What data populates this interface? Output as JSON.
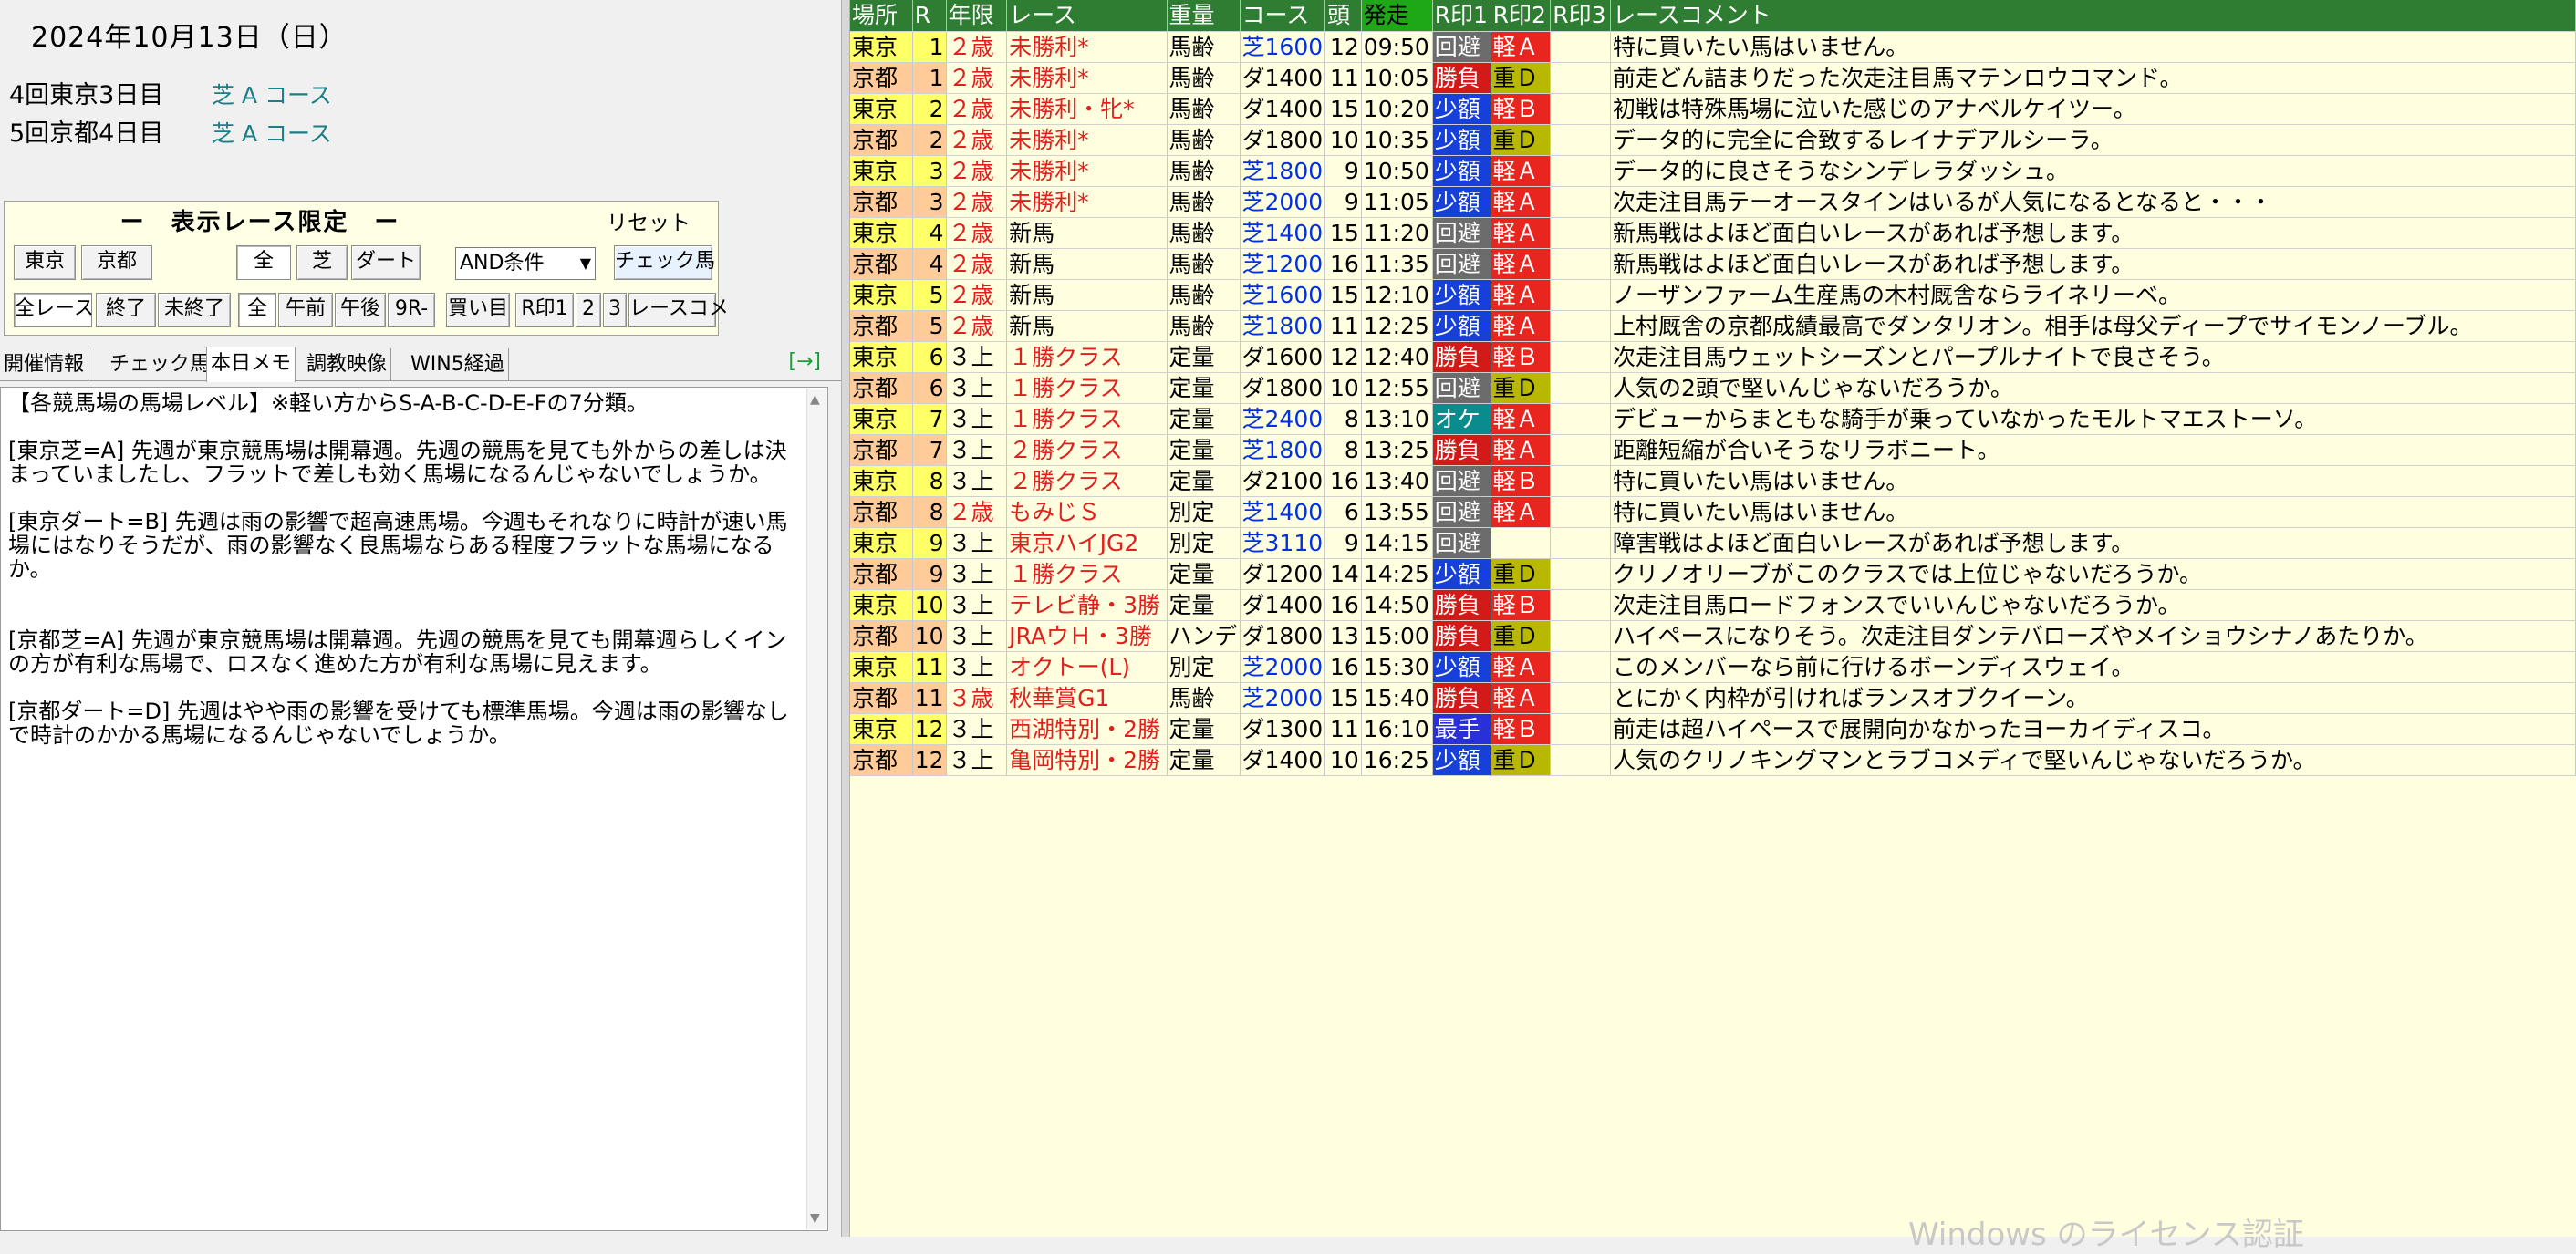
{
  "header": {
    "date": "2024年10月13日（日）",
    "meetings": [
      {
        "name": "4回東京3日目",
        "course": "芝 A コース"
      },
      {
        "name": "5回京都4日目",
        "course": "芝 A コース"
      }
    ]
  },
  "filter": {
    "title": "ー　表示レース限定　ー",
    "reset": "リセット",
    "row1": {
      "tokyo": "東京",
      "kyoto": "京都",
      "all": "全",
      "turf": "芝",
      "dirt": "ダート",
      "condition": "AND条件",
      "check_horse": "チェック馬"
    },
    "row2": {
      "all_races": "全レース",
      "finished": "終了",
      "unfinished": "未終了",
      "all": "全",
      "am": "午前",
      "pm": "午後",
      "r9": "9R-",
      "buy": "買い目",
      "rmark1": "R印1",
      "r2": "2",
      "r3": "3",
      "race_comment": "レースコメ"
    }
  },
  "tabs": {
    "items": [
      "開催情報",
      "チェック馬",
      "本日メモ",
      "調教映像",
      "WIN5経過"
    ],
    "active": "本日メモ",
    "arrow": "[→]"
  },
  "memo": {
    "text": "【各競馬場の馬場レベル】※軽い方からS-A-B-C-D-E-Fの7分類。\n\n[東京芝=A] 先週が東京競馬場は開幕週。先週の競馬を見ても外からの差しは決まっていましたし、フラットで差しも効く馬場になるんじゃないでしょうか。\n\n[東京ダート=B] 先週は雨の影響で超高速馬場。今週もそれなりに時計が速い馬場にはなりそうだが、雨の影響なく良馬場ならある程度フラットな馬場になるか。\n\n\n[京都芝=A] 先週が東京競馬場は開幕週。先週の競馬を見ても開幕週らしくインの方が有利な馬場で、ロスなく進めた方が有利な馬場に見えます。\n\n[京都ダート=D] 先週はやや雨の影響を受けても標準馬場。今週は雨の影響なしで時計のかかる馬場になるんじゃないでしょうか。"
  },
  "grid": {
    "headers": [
      "場所",
      "R",
      "年限",
      "レース",
      "重量",
      "コース",
      "頭",
      "発走",
      "R印1",
      "R印2",
      "R印3",
      "レースコメント"
    ],
    "rows": [
      {
        "venue": "東京",
        "r": "1",
        "age": "２歳",
        "race": "未勝利*",
        "weight": "馬齢",
        "course": "芝1600",
        "heads": "12",
        "start": "09:50",
        "r1": "回避",
        "r2": "軽Ａ",
        "r3": "",
        "comment": "特に買いたい馬はいません。"
      },
      {
        "venue": "京都",
        "r": "1",
        "age": "２歳",
        "race": "未勝利*",
        "weight": "馬齢",
        "course": "ダ1400",
        "heads": "11",
        "start": "10:05",
        "r1": "勝負",
        "r2": "重Ｄ",
        "r3": "",
        "comment": "前走どん詰まりだった次走注目馬マテンロウコマンド。"
      },
      {
        "venue": "東京",
        "r": "2",
        "age": "２歳",
        "race": "未勝利・牝*",
        "weight": "馬齢",
        "course": "ダ1400",
        "heads": "15",
        "start": "10:20",
        "r1": "少額",
        "r2": "軽Ｂ",
        "r3": "",
        "comment": "初戦は特殊馬場に泣いた感じのアナベルケイツー。"
      },
      {
        "venue": "京都",
        "r": "2",
        "age": "２歳",
        "race": "未勝利*",
        "weight": "馬齢",
        "course": "ダ1800",
        "heads": "10",
        "start": "10:35",
        "r1": "少額",
        "r2": "重Ｄ",
        "r3": "",
        "comment": "データ的に完全に合致するレイナデアルシーラ。"
      },
      {
        "venue": "東京",
        "r": "3",
        "age": "２歳",
        "race": "未勝利*",
        "weight": "馬齢",
        "course": "芝1800",
        "heads": "9",
        "start": "10:50",
        "r1": "少額",
        "r2": "軽Ａ",
        "r3": "",
        "comment": "データ的に良さそうなシンデレラダッシュ。"
      },
      {
        "venue": "京都",
        "r": "3",
        "age": "２歳",
        "race": "未勝利*",
        "weight": "馬齢",
        "course": "芝2000",
        "heads": "9",
        "start": "11:05",
        "r1": "少額",
        "r2": "軽Ａ",
        "r3": "",
        "comment": "次走注目馬テーオースタインはいるが人気になるとなると・・・"
      },
      {
        "venue": "東京",
        "r": "4",
        "age": "２歳",
        "race": "新馬",
        "weight": "馬齢",
        "course": "芝1400",
        "heads": "15",
        "start": "11:20",
        "r1": "回避",
        "r2": "軽Ａ",
        "r3": "",
        "comment": "新馬戦はよほど面白いレースがあれば予想します。"
      },
      {
        "venue": "京都",
        "r": "4",
        "age": "２歳",
        "race": "新馬",
        "weight": "馬齢",
        "course": "芝1200",
        "heads": "16",
        "start": "11:35",
        "r1": "回避",
        "r2": "軽Ａ",
        "r3": "",
        "comment": "新馬戦はよほど面白いレースがあれば予想します。"
      },
      {
        "venue": "東京",
        "r": "5",
        "age": "２歳",
        "race": "新馬",
        "weight": "馬齢",
        "course": "芝1600",
        "heads": "15",
        "start": "12:10",
        "r1": "少額",
        "r2": "軽Ａ",
        "r3": "",
        "comment": "ノーザンファーム生産馬の木村厩舎ならライネリーベ。"
      },
      {
        "venue": "京都",
        "r": "5",
        "age": "２歳",
        "race": "新馬",
        "weight": "馬齢",
        "course": "芝1800",
        "heads": "11",
        "start": "12:25",
        "r1": "少額",
        "r2": "軽Ａ",
        "r3": "",
        "comment": "上村厩舎の京都成績最高でダンタリオン。相手は母父ディープでサイモンノーブル。"
      },
      {
        "venue": "東京",
        "r": "6",
        "age": "３上",
        "race": "１勝クラス",
        "weight": "定量",
        "course": "ダ1600",
        "heads": "12",
        "start": "12:40",
        "r1": "勝負",
        "r2": "軽Ｂ",
        "r3": "",
        "comment": "次走注目馬ウェットシーズンとパープルナイトで良さそう。"
      },
      {
        "venue": "京都",
        "r": "6",
        "age": "３上",
        "race": "１勝クラス",
        "weight": "定量",
        "course": "ダ1800",
        "heads": "10",
        "start": "12:55",
        "r1": "回避",
        "r2": "重Ｄ",
        "r3": "",
        "comment": "人気の2頭で堅いんじゃないだろうか。"
      },
      {
        "venue": "東京",
        "r": "7",
        "age": "３上",
        "race": "１勝クラス",
        "weight": "定量",
        "course": "芝2400",
        "heads": "8",
        "start": "13:10",
        "r1": "オケ",
        "r2": "軽Ａ",
        "r3": "",
        "comment": "デビューからまともな騎手が乗っていなかったモルトマエストーソ。"
      },
      {
        "venue": "京都",
        "r": "7",
        "age": "３上",
        "race": "２勝クラス",
        "weight": "定量",
        "course": "芝1800",
        "heads": "8",
        "start": "13:25",
        "r1": "勝負",
        "r2": "軽Ａ",
        "r3": "",
        "comment": "距離短縮が合いそうなリラボニート。"
      },
      {
        "venue": "東京",
        "r": "8",
        "age": "３上",
        "race": "２勝クラス",
        "weight": "定量",
        "course": "ダ2100",
        "heads": "16",
        "start": "13:40",
        "r1": "回避",
        "r2": "軽Ｂ",
        "r3": "",
        "comment": "特に買いたい馬はいません。"
      },
      {
        "venue": "京都",
        "r": "8",
        "age": "２歳",
        "race": "もみじＳ",
        "weight": "別定",
        "course": "芝1400",
        "heads": "6",
        "start": "13:55",
        "r1": "回避",
        "r2": "軽Ａ",
        "r3": "",
        "comment": "特に買いたい馬はいません。"
      },
      {
        "venue": "東京",
        "r": "9",
        "age": "３上",
        "race": "東京ハイJG2",
        "weight": "別定",
        "course": "芝3110",
        "heads": "9",
        "start": "14:15",
        "r1": "回避",
        "r2": "",
        "r3": "",
        "comment": "障害戦はよほど面白いレースがあれば予想します。"
      },
      {
        "venue": "京都",
        "r": "9",
        "age": "３上",
        "race": "１勝クラス",
        "weight": "定量",
        "course": "ダ1200",
        "heads": "14",
        "start": "14:25",
        "r1": "少額",
        "r2": "重Ｄ",
        "r3": "",
        "comment": "クリノオリーブがこのクラスでは上位じゃないだろうか。"
      },
      {
        "venue": "東京",
        "r": "10",
        "age": "３上",
        "race": "テレビ静・3勝",
        "weight": "定量",
        "course": "ダ1400",
        "heads": "16",
        "start": "14:50",
        "r1": "勝負",
        "r2": "軽Ｂ",
        "r3": "",
        "comment": "次走注目馬ロードフォンスでいいんじゃないだろうか。"
      },
      {
        "venue": "京都",
        "r": "10",
        "age": "３上",
        "race": "JRAウＨ・3勝",
        "weight": "ハンデ",
        "course": "ダ1800",
        "heads": "13",
        "start": "15:00",
        "r1": "勝負",
        "r2": "重Ｄ",
        "r3": "",
        "comment": "ハイペースになりそう。次走注目ダンテバローズやメイショウシナノあたりか。"
      },
      {
        "venue": "東京",
        "r": "11",
        "age": "３上",
        "race": "オクトー(L)",
        "weight": "別定",
        "course": "芝2000",
        "heads": "16",
        "start": "15:30",
        "r1": "少額",
        "r2": "軽Ａ",
        "r3": "",
        "comment": "このメンバーなら前に行けるボーンディスウェイ。"
      },
      {
        "venue": "京都",
        "r": "11",
        "age": "３歳",
        "race": "秋華賞G1",
        "weight": "馬齢",
        "course": "芝2000",
        "heads": "15",
        "start": "15:40",
        "r1": "勝負",
        "r2": "軽Ａ",
        "r3": "",
        "comment": "とにかく内枠が引ければランスオブクイーン。"
      },
      {
        "venue": "東京",
        "r": "12",
        "age": "３上",
        "race": "西湖特別・2勝",
        "weight": "定量",
        "course": "ダ1300",
        "heads": "11",
        "start": "16:10",
        "r1": "最手",
        "r2": "軽Ｂ",
        "r3": "",
        "comment": "前走は超ハイペースで展開向かなかったヨーカイディスコ。"
      },
      {
        "venue": "京都",
        "r": "12",
        "age": "３上",
        "race": "亀岡特別・2勝",
        "weight": "定量",
        "course": "ダ1400",
        "heads": "10",
        "start": "16:25",
        "r1": "少額",
        "r2": "重Ｄ",
        "r3": "",
        "comment": "人気のクリノキングマンとラブコメディで堅いんじゃないだろうか。"
      }
    ]
  },
  "watermark": "Windows のライセンス認証",
  "colors": {
    "header_green": "#2e7d32",
    "tokyo_bg": "#ffff66",
    "kyoto_bg": "#ffcc99",
    "grid_bg": "#ffffe0",
    "red_text": "#e0201c",
    "blue_text": "#0030e0"
  }
}
